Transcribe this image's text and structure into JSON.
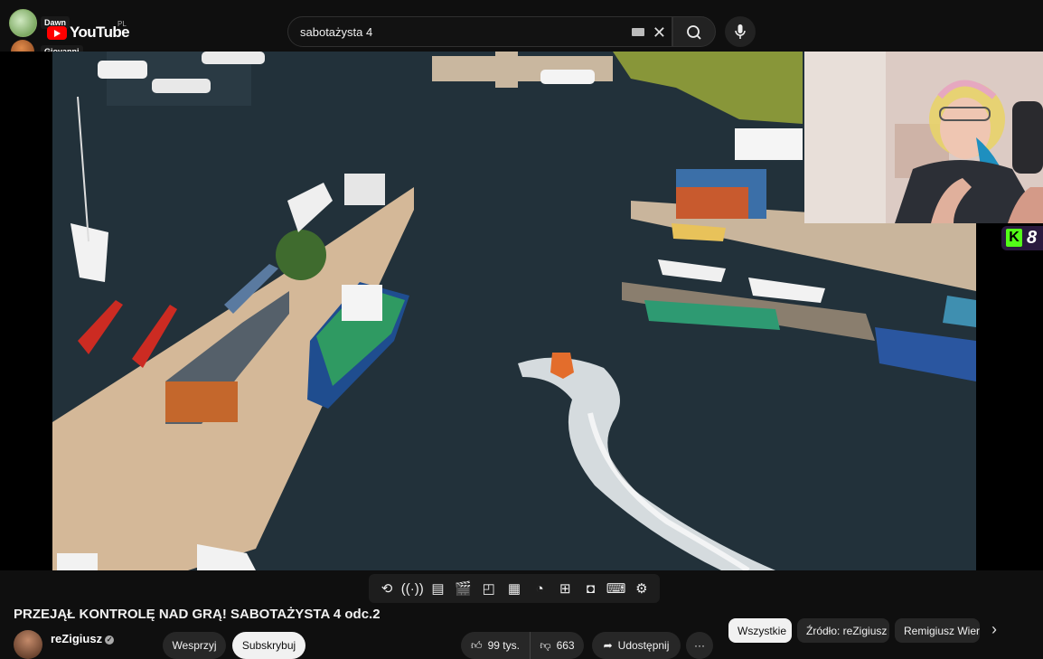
{
  "viewers": {
    "first": "Dawn",
    "second": "Giovanni"
  },
  "logo": {
    "text": "YouTube",
    "country": "PL"
  },
  "search": {
    "query": "sabotażysta 4"
  },
  "kick": {
    "letter": "K",
    "viewer_count": "8"
  },
  "player": {
    "controls": [
      "loop-icon",
      "radio-icon",
      "stats-icon",
      "clapper-icon",
      "picture-in-picture-icon",
      "captions-icon",
      "speed-icon",
      "add-playlist-icon",
      "screenshot-icon",
      "keyboard-icon",
      "settings-icon"
    ]
  },
  "video": {
    "title": "PRZEJĄŁ KONTROLĘ NAD GRĄ! SABOTAŻYSTA 4 odc.2",
    "channel": "reZigiusz",
    "support_label": "Wesprzyj",
    "subscribe_label": "Subskrybuj",
    "likes": "99 tys.",
    "dislikes": "663",
    "share_label": "Udostępnij",
    "more_label": "···"
  },
  "chips": [
    "Wszystkie",
    "Źródło: reZigiusz",
    "Remigiusz Wierzgoń"
  ]
}
